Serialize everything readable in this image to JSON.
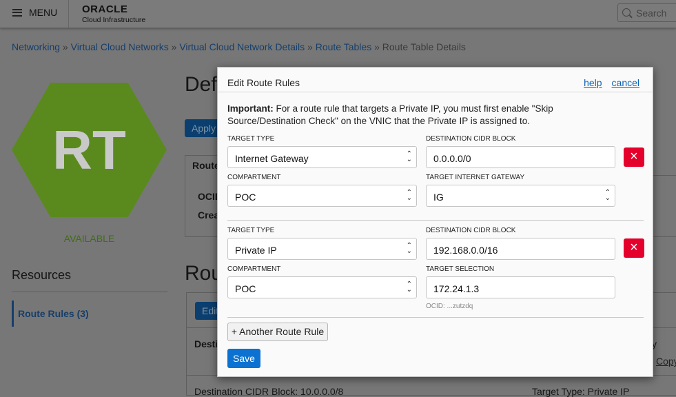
{
  "header": {
    "menu_label": "MENU",
    "logo_brand": "ORACLE",
    "logo_sub": "Cloud Infrastructure",
    "search_placeholder": "Search"
  },
  "breadcrumb": [
    {
      "label": "Networking"
    },
    {
      "label": "Virtual Cloud Networks"
    },
    {
      "label": "Virtual Cloud Network Details"
    },
    {
      "label": "Route Tables"
    },
    {
      "label": "Route Table Details"
    }
  ],
  "breadcrumb_sep": "»",
  "resource": {
    "icon_text": "RT",
    "status": "AVAILABLE",
    "hex_color": "#5a8a1e"
  },
  "sidebar": {
    "title": "Resources",
    "items": [
      {
        "label": "Route Rules (3)"
      }
    ]
  },
  "background": {
    "title": "Def",
    "apply_btn": "Apply",
    "info_title": "Route",
    "ocid": "OCID",
    "created": "Crea",
    "section_title": "Rou",
    "edit_btn": "Edit",
    "col_dest": "Desti",
    "col_y": "y",
    "copy_link": "Copy",
    "row_text": "Destination CIDR Block: 10.0.0.0/8",
    "row_target": "Target Type: Private IP"
  },
  "modal": {
    "title": "Edit Route Rules",
    "help": "help",
    "cancel": "cancel",
    "important_label": "Important:",
    "important_text": " For a route rule that targets a Private IP, you must first enable \"Skip Source/Destination Check\" on the VNIC that the Private IP is assigned to.",
    "rules": [
      {
        "target_type_label": "TARGET TYPE",
        "target_type": "Internet Gateway",
        "dest_label": "DESTINATION CIDR BLOCK",
        "dest": "0.0.0.0/0",
        "compartment_label": "COMPARTMENT",
        "compartment": "POC",
        "target_label": "TARGET INTERNET GATEWAY",
        "target": "IG"
      },
      {
        "target_type_label": "TARGET TYPE",
        "target_type": "Private IP",
        "dest_label": "DESTINATION CIDR BLOCK",
        "dest": "192.168.0.0/16",
        "compartment_label": "COMPARTMENT",
        "compartment": "POC",
        "target_label": "TARGET SELECTION",
        "target": "172.24.1.3",
        "ocid": "OCID: ...zutzdq"
      }
    ],
    "add_rule": "+ Another Route Rule",
    "save": "Save",
    "delete_color": "#e4002b",
    "accent": "#0b72d1"
  }
}
